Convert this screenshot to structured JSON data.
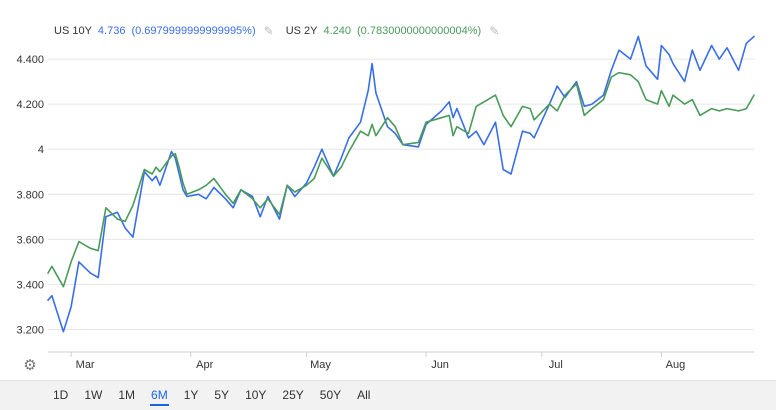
{
  "legend": {
    "series1": {
      "name": "US 10Y",
      "value": "4.736",
      "change": "(0.6979999999999995%)"
    },
    "series2": {
      "name": "US 2Y",
      "value": "4.240",
      "change": "(0.7830000000000004%)"
    },
    "edit_icon": "pencil-icon"
  },
  "settings_icon": "gear-icon",
  "ranges": [
    "1D",
    "1W",
    "1M",
    "6M",
    "1Y",
    "5Y",
    "10Y",
    "25Y",
    "50Y",
    "All"
  ],
  "active_range": "6M",
  "colors": {
    "series1": "#3a6ee8",
    "series2": "#4a9a5a",
    "grid": "#e6e6e6",
    "axis_text": "#333333"
  },
  "chart_data": {
    "type": "line",
    "title": "",
    "xlabel": "",
    "ylabel": "",
    "ylim": [
      3.1,
      4.6
    ],
    "yticks": [
      3.2,
      3.4,
      3.6,
      3.8,
      4.0,
      4.2,
      4.4
    ],
    "ytick_labels": [
      "3.200",
      "3.400",
      "3.600",
      "3.800",
      "4",
      "4.200",
      "4.400"
    ],
    "xlim": [
      "2023-02-23",
      "2023-08-25"
    ],
    "xticks": [
      {
        "date": "2023-03-01",
        "label": "Mar"
      },
      {
        "date": "2023-04-01",
        "label": "Apr"
      },
      {
        "date": "2023-05-01",
        "label": "May"
      },
      {
        "date": "2023-06-01",
        "label": "Jun"
      },
      {
        "date": "2023-07-01",
        "label": "Jul"
      },
      {
        "date": "2023-08-01",
        "label": "Aug"
      }
    ],
    "series": [
      {
        "name": "US 10Y",
        "color": "#3a6ee8",
        "x": [
          "2023-02-23",
          "2023-02-24",
          "2023-02-27",
          "2023-03-01",
          "2023-03-03",
          "2023-03-06",
          "2023-03-08",
          "2023-03-10",
          "2023-03-13",
          "2023-03-15",
          "2023-03-17",
          "2023-03-20",
          "2023-03-22",
          "2023-03-23",
          "2023-03-24",
          "2023-03-27",
          "2023-03-28",
          "2023-03-29",
          "2023-03-30",
          "2023-03-31",
          "2023-04-03",
          "2023-04-05",
          "2023-04-07",
          "2023-04-10",
          "2023-04-12",
          "2023-04-14",
          "2023-04-17",
          "2023-04-19",
          "2023-04-21",
          "2023-04-24",
          "2023-04-26",
          "2023-04-28",
          "2023-05-01",
          "2023-05-03",
          "2023-05-05",
          "2023-05-08",
          "2023-05-10",
          "2023-05-12",
          "2023-05-15",
          "2023-05-17",
          "2023-05-18",
          "2023-05-19",
          "2023-05-22",
          "2023-05-24",
          "2023-05-26",
          "2023-05-30",
          "2023-06-01",
          "2023-06-05",
          "2023-06-07",
          "2023-06-08",
          "2023-06-09",
          "2023-06-12",
          "2023-06-14",
          "2023-06-16",
          "2023-06-19",
          "2023-06-21",
          "2023-06-23",
          "2023-06-26",
          "2023-06-28",
          "2023-06-29",
          "2023-07-03",
          "2023-07-05",
          "2023-07-07",
          "2023-07-10",
          "2023-07-12",
          "2023-07-14",
          "2023-07-17",
          "2023-07-19",
          "2023-07-21",
          "2023-07-24",
          "2023-07-26",
          "2023-07-28",
          "2023-07-31",
          "2023-08-01",
          "2023-08-03",
          "2023-08-04",
          "2023-08-07",
          "2023-08-09",
          "2023-08-11",
          "2023-08-14",
          "2023-08-16",
          "2023-08-18",
          "2023-08-21",
          "2023-08-23",
          "2023-08-25"
        ],
        "values": [
          3.33,
          3.35,
          3.19,
          3.3,
          3.5,
          3.45,
          3.43,
          3.7,
          3.72,
          3.65,
          3.61,
          3.9,
          3.86,
          3.88,
          3.84,
          3.99,
          3.96,
          3.89,
          3.82,
          3.79,
          3.8,
          3.78,
          3.83,
          3.78,
          3.74,
          3.82,
          3.79,
          3.7,
          3.79,
          3.69,
          3.84,
          3.79,
          3.85,
          3.92,
          4.0,
          3.88,
          3.96,
          4.05,
          4.12,
          4.26,
          4.38,
          4.25,
          4.1,
          4.07,
          4.02,
          4.01,
          4.11,
          4.17,
          4.21,
          4.14,
          4.18,
          4.05,
          4.08,
          4.02,
          4.12,
          3.91,
          3.89,
          4.08,
          4.07,
          4.05,
          4.2,
          4.28,
          4.23,
          4.3,
          4.19,
          4.2,
          4.24,
          4.35,
          4.44,
          4.4,
          4.5,
          4.37,
          4.31,
          4.46,
          4.42,
          4.38,
          4.3,
          4.44,
          4.35,
          4.46,
          4.4,
          4.45,
          4.35,
          4.47,
          4.5
        ]
      },
      {
        "name": "US 2Y",
        "color": "#4a9a5a",
        "x": [
          "2023-02-23",
          "2023-02-24",
          "2023-02-27",
          "2023-03-01",
          "2023-03-03",
          "2023-03-06",
          "2023-03-08",
          "2023-03-10",
          "2023-03-13",
          "2023-03-15",
          "2023-03-17",
          "2023-03-20",
          "2023-03-22",
          "2023-03-23",
          "2023-03-24",
          "2023-03-27",
          "2023-03-28",
          "2023-03-29",
          "2023-03-30",
          "2023-03-31",
          "2023-04-03",
          "2023-04-05",
          "2023-04-07",
          "2023-04-10",
          "2023-04-12",
          "2023-04-14",
          "2023-04-17",
          "2023-04-19",
          "2023-04-21",
          "2023-04-24",
          "2023-04-26",
          "2023-04-28",
          "2023-05-01",
          "2023-05-03",
          "2023-05-05",
          "2023-05-08",
          "2023-05-10",
          "2023-05-12",
          "2023-05-15",
          "2023-05-17",
          "2023-05-18",
          "2023-05-19",
          "2023-05-22",
          "2023-05-24",
          "2023-05-26",
          "2023-05-30",
          "2023-06-01",
          "2023-06-05",
          "2023-06-07",
          "2023-06-08",
          "2023-06-09",
          "2023-06-12",
          "2023-06-14",
          "2023-06-16",
          "2023-06-19",
          "2023-06-21",
          "2023-06-23",
          "2023-06-26",
          "2023-06-28",
          "2023-06-29",
          "2023-07-03",
          "2023-07-05",
          "2023-07-07",
          "2023-07-10",
          "2023-07-12",
          "2023-07-14",
          "2023-07-17",
          "2023-07-19",
          "2023-07-21",
          "2023-07-24",
          "2023-07-26",
          "2023-07-28",
          "2023-07-31",
          "2023-08-01",
          "2023-08-03",
          "2023-08-04",
          "2023-08-07",
          "2023-08-09",
          "2023-08-11",
          "2023-08-14",
          "2023-08-16",
          "2023-08-18",
          "2023-08-21",
          "2023-08-23",
          "2023-08-25"
        ],
        "values": [
          3.45,
          3.48,
          3.39,
          3.5,
          3.59,
          3.56,
          3.55,
          3.74,
          3.69,
          3.68,
          3.75,
          3.91,
          3.89,
          3.92,
          3.9,
          3.97,
          3.98,
          3.92,
          3.85,
          3.8,
          3.82,
          3.84,
          3.87,
          3.8,
          3.76,
          3.82,
          3.78,
          3.74,
          3.78,
          3.71,
          3.84,
          3.81,
          3.84,
          3.87,
          3.96,
          3.88,
          3.92,
          3.99,
          4.08,
          4.06,
          4.11,
          4.06,
          4.14,
          4.1,
          4.02,
          4.03,
          4.12,
          4.14,
          4.15,
          4.06,
          4.1,
          4.07,
          4.19,
          4.21,
          4.24,
          4.15,
          4.1,
          4.19,
          4.18,
          4.13,
          4.2,
          4.17,
          4.24,
          4.29,
          4.15,
          4.18,
          4.22,
          4.32,
          4.34,
          4.33,
          4.3,
          4.22,
          4.2,
          4.26,
          4.19,
          4.24,
          4.2,
          4.22,
          4.15,
          4.18,
          4.17,
          4.18,
          4.17,
          4.18,
          4.24
        ]
      }
    ]
  }
}
